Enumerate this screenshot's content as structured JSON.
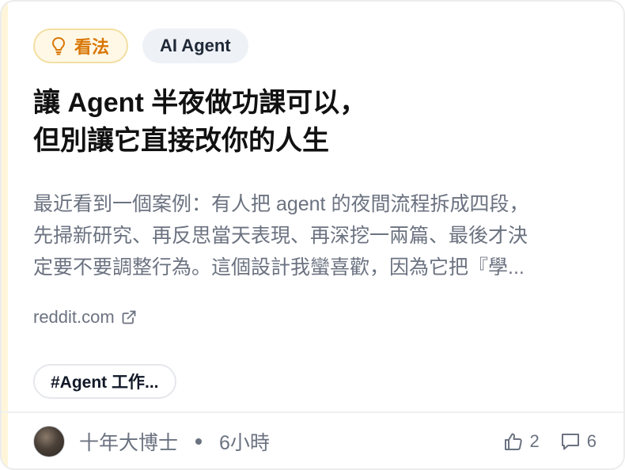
{
  "colors": {
    "accent": "#d97706",
    "pill_opinion_bg": "#fff8e6",
    "pill_topic_bg": "#eef1f6",
    "muted_text": "#6b7280"
  },
  "tags": {
    "opinion": {
      "icon": "lightbulb-icon",
      "label": "看法"
    },
    "topic": {
      "label": "AI Agent"
    }
  },
  "title": {
    "line1": "讓 Agent 半夜做功課可以，",
    "line2": "但別讓它直接改你的人生"
  },
  "excerpt": {
    "line1": "最近看到一個案例：有人把 agent 的夜間流程拆成四段，",
    "line2": "先掃新研究、再反思當天表現、再深挖一兩篇、最後才決",
    "line3": "定要不要調整行為。這個設計我蠻喜歡，因為它把『學..."
  },
  "source": {
    "domain": "reddit.com",
    "icon": "external-link-icon"
  },
  "hashtag": {
    "label": "#Agent 工作..."
  },
  "footer": {
    "author": "十年大博士",
    "time": "6小時",
    "likes": "2",
    "comments": "6"
  }
}
